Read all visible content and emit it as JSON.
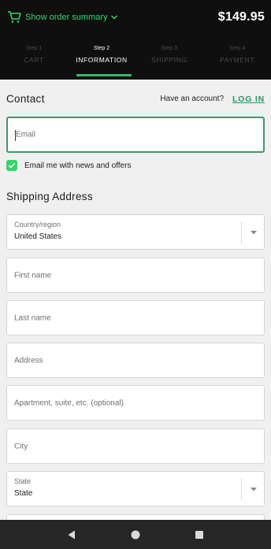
{
  "header": {
    "summary_label": "Show order summary",
    "total": "$149.95",
    "icons": {
      "cart": "cart-icon",
      "chevron": "chevron-down-icon"
    }
  },
  "steps": [
    {
      "num": "Step 1",
      "label": "CART"
    },
    {
      "num": "Step 2",
      "label": "INFORMATION",
      "active": true
    },
    {
      "num": "Step 3",
      "label": "SHIPPING"
    },
    {
      "num": "Step 4",
      "label": "PAYMENT"
    }
  ],
  "contact": {
    "title": "Contact",
    "have_account": "Have an account?",
    "login": "LOG IN",
    "email_placeholder": "Email",
    "newsletter_label": "Email me with news and offers",
    "newsletter_checked": true
  },
  "shipping": {
    "title": "Shipping Address",
    "country_label": "Country/region",
    "country_value": "United States",
    "first_name_placeholder": "First name",
    "last_name_placeholder": "Last name",
    "address_placeholder": "Address",
    "apartment_placeholder": "Apartment, suite, etc. (optional)",
    "city_placeholder": "City",
    "state_label": "State",
    "state_value": "State"
  },
  "nav": {
    "back": "back-icon",
    "home": "home-icon",
    "recents": "recents-icon"
  },
  "colors": {
    "accent_green": "#34d46a",
    "link_green": "#1f9a63",
    "header_bg": "#0f0f0f",
    "page_bg": "#f0f0f0"
  }
}
